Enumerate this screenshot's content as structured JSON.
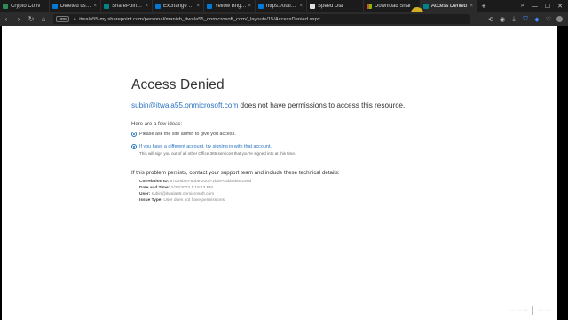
{
  "browser": {
    "tabs": [
      {
        "label": "Crypto Conv",
        "favicon_color": "#2e8b57",
        "active": false
      },
      {
        "label": "Deleted users",
        "favicon_color": "#0078d4",
        "active": false
      },
      {
        "label": "SharePoint adm",
        "favicon_color": "#038387",
        "active": false
      },
      {
        "label": "Exchange admi",
        "favicon_color": "#0078d4",
        "active": false
      },
      {
        "label": "Yellow Bright Bi",
        "favicon_color": "#0078d4",
        "active": false
      },
      {
        "label": "https://outlook",
        "favicon_color": "#0078d4",
        "active": false
      },
      {
        "label": "Speed Dial",
        "favicon_color": "#e0e0e0",
        "active": false
      },
      {
        "label": "Download Shar",
        "favicon_color": "#e04a2f",
        "active": false
      },
      {
        "label": "Access Denied",
        "favicon_color": "#038387",
        "active": true
      }
    ],
    "new_tab_label": "+",
    "vpn_label": "VPN",
    "url": "itwala55-my.sharepoint.com/personal/manish_itwala55_onmicrosoft_com/_layouts/15/AccessDenied.aspx"
  },
  "page": {
    "title": "Access Denied",
    "account": "subin@itwala55.onmicrosoft.com",
    "message_suffix": " does not have permissions to access this resource.",
    "ideas_heading": "Here are a few ideas:",
    "idea_1": "Please ask the site admin to give you access.",
    "idea_2_link": "If you have a different account, try signing in with that account.",
    "idea_2_sub": "This will sign you out of all other Office 365 services that you're signed into at this time.",
    "persist_text": "If this problem persists, contact your support team and include these technical details:",
    "details": [
      {
        "label": "Correlation ID:",
        "value": "67d29bb0-80b6-2000-1bb9-d5bb4b6c190d"
      },
      {
        "label": "Date and Time:",
        "value": "2/22/2023 1:19:13 PM"
      },
      {
        "label": "User:",
        "value": "subin@itwala55.onmicrosoft.com"
      },
      {
        "label": "Issue Type:",
        "value": "User does not have permissions."
      }
    ]
  },
  "colors": {
    "link": "#2872c2",
    "tab_active_indicator": "#4a9eff",
    "cursor_highlight": "#f0c828"
  }
}
